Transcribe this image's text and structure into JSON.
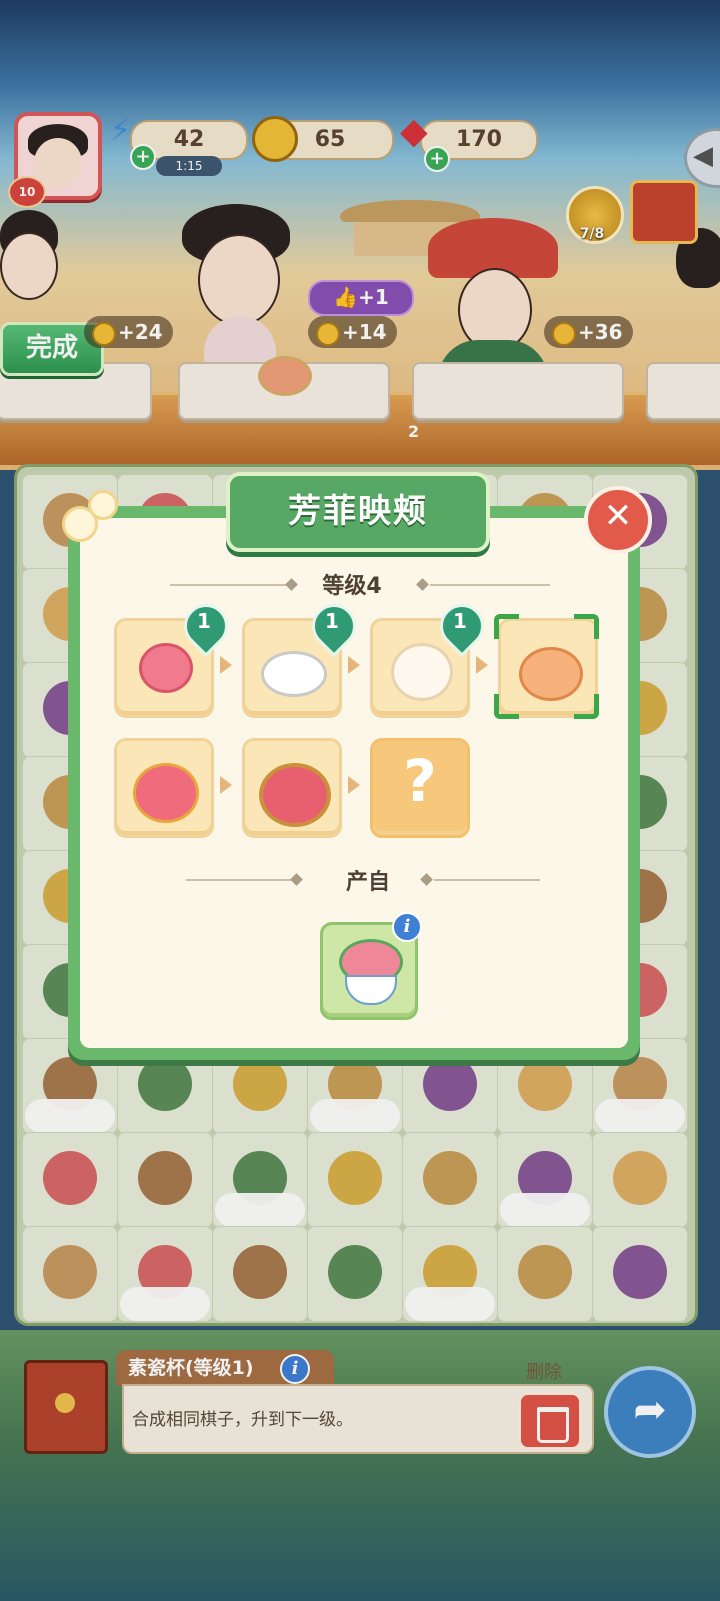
{
  "hud": {
    "player_level": "10",
    "energy": "42",
    "energy_timer": "1:15",
    "coins": "65",
    "gems": "170",
    "task_progress": "7/8"
  },
  "customers": {
    "done_label": "完成",
    "rewards": [
      "+24",
      "+14",
      "+36"
    ],
    "like_bonus": "+1",
    "counter_number": "2"
  },
  "modal": {
    "title": "芳菲映颊",
    "level_label": "等级4",
    "chain_row1": [
      {
        "name": "peony",
        "count": "1"
      },
      {
        "name": "mortar",
        "count": "1"
      },
      {
        "name": "round-box",
        "count": "1"
      },
      {
        "name": "rouge-box-selected",
        "count": ""
      }
    ],
    "chain_row2": [
      {
        "name": "rouge-pot"
      },
      {
        "name": "ornate-rouge-box"
      },
      {
        "name": "unknown"
      }
    ],
    "unknown_mark": "?",
    "source_label": "产自",
    "source_item": "flower-bowl",
    "info_mark": "i"
  },
  "bottom": {
    "item_name": "素瓷杯(等级1)",
    "description": "合成相同棋子，升到下一级。",
    "delete_label": "删除",
    "info_mark": "i"
  },
  "colors": {
    "modal_green": "#69b86b",
    "badge_green": "#2f9a74",
    "close_red": "#e25a49",
    "slot_gold": "#fbe6b8"
  }
}
